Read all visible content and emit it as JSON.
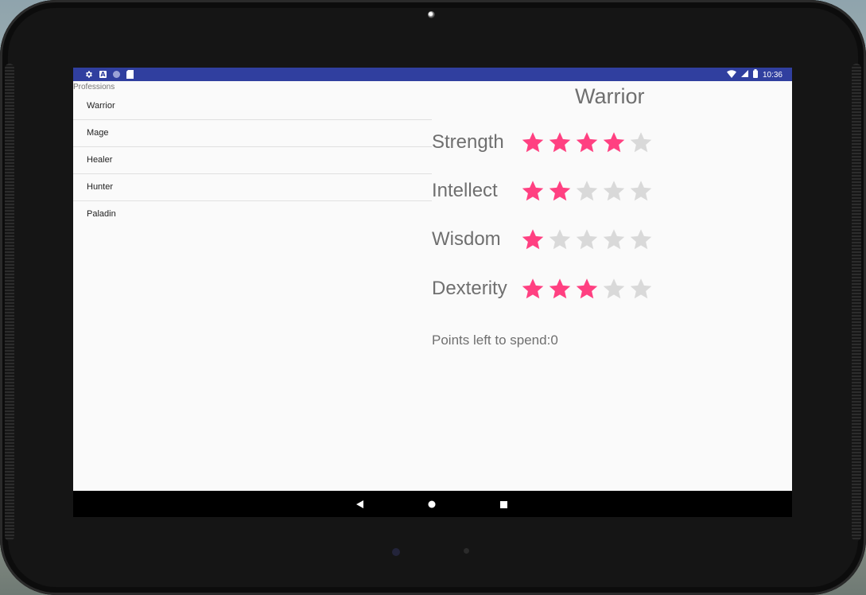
{
  "status_bar": {
    "time": "10:36",
    "left_icons": [
      "gear-icon",
      "a-badge-icon",
      "circle-icon",
      "sd-card-icon"
    ],
    "right_icons": [
      "wifi-icon",
      "signal-icon",
      "battery-icon"
    ],
    "a_badge_text": "A",
    "color": "#303f9f"
  },
  "professions": {
    "label": "Professions",
    "items": [
      {
        "label": "Warrior"
      },
      {
        "label": "Mage"
      },
      {
        "label": "Healer"
      },
      {
        "label": "Hunter"
      },
      {
        "label": "Paladin"
      }
    ]
  },
  "detail": {
    "title": "Warrior",
    "max_stars": 5,
    "star_on_color": "#ff4081",
    "star_off_color": "#d9d9d9",
    "stats": [
      {
        "label": "Strength",
        "rating": 4
      },
      {
        "label": "Intellect",
        "rating": 2
      },
      {
        "label": "Wisdom",
        "rating": 1
      },
      {
        "label": "Dexterity",
        "rating": 3
      }
    ],
    "points_left_text": "Points left to spend:0"
  },
  "nav_bar": {
    "icons": [
      "back-icon",
      "home-icon",
      "recents-icon"
    ]
  }
}
